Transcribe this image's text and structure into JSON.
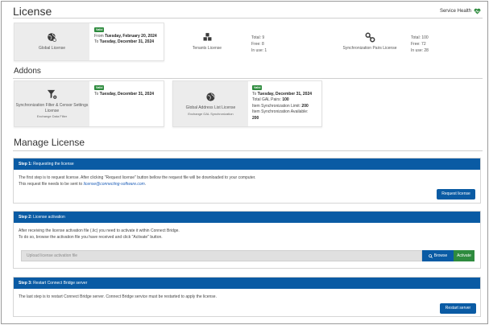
{
  "header": {
    "title": "License",
    "service_health": "Service Health"
  },
  "license_cards": {
    "global": {
      "label": "Global License",
      "badge": "Valid",
      "from_prefix": "From",
      "from_date": "Tuesday, February 20, 2024",
      "to_prefix": "To",
      "to_date": "Tuesday, December 31, 2024"
    },
    "tenants": {
      "label": "Tenants License",
      "total": "Total: 9",
      "free": "Free: 8",
      "in_use": "In use: 1"
    },
    "sync_pairs": {
      "label": "Synchronization Pairs License",
      "total": "Total: 100",
      "free": "Free: 72",
      "in_use": "In use: 28"
    }
  },
  "addons": {
    "title": "Addons",
    "filter": {
      "label": "Synchronization Filter & Censor Settings License",
      "sublabel": "Exchange Data Filter",
      "badge": "Valid",
      "to_prefix": "To",
      "to_date": "Tuesday, December 31, 2024"
    },
    "gal": {
      "label": "Global Address List License",
      "sublabel": "Exchange GAL Synchronization",
      "badge": "Valid",
      "to_prefix": "To",
      "to_date": "Tuesday, December 31, 2024",
      "pairs_label": "Total GAL Pairs:",
      "pairs_value": "100",
      "limit_label": "Item Synchronization Limit:",
      "limit_value": "200",
      "available_label": "Item Synchronization Available:",
      "available_value": "200"
    }
  },
  "manage": {
    "title": "Manage License",
    "step1": {
      "step_label": "Step 1:",
      "title": "Requesting the license",
      "line1": "The first step is to request license. After clicking \"Request license\" button bellow the request file will be downloaded to your computer.",
      "line2_prefix": "This request file needs to be sent to",
      "email": "license@connecting-software.com",
      "line2_suffix": ".",
      "button": "Request license"
    },
    "step2": {
      "step_label": "Step 2:",
      "title": "License activation",
      "line1": "After receiving the license activation file (.lic) you need to activate it within Connect Bridge.",
      "line2": "To do so, browse the activation file you have received and click \"Activate\" button.",
      "placeholder": "Upload license activation file",
      "browse": "Browse",
      "activate": "Activate"
    },
    "step3": {
      "step_label": "Step 3:",
      "title": "Restart Connect Bridge server",
      "line1": "The last step is to restart Connect Bridge server. Connect Bridge service must be restarted to apply the license.",
      "button": "Restart server"
    }
  },
  "colors": {
    "accent": "#0a5ba4",
    "valid": "#2e8b3e",
    "health": "#2e8b3e"
  }
}
